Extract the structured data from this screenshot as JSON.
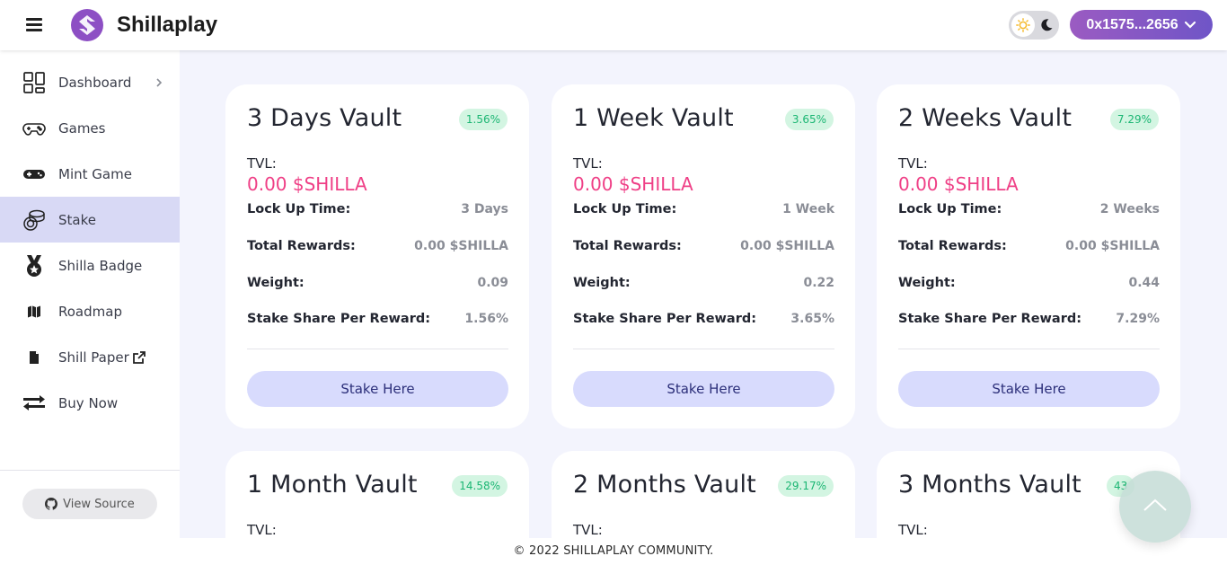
{
  "header": {
    "brand": "Shillaplay",
    "wallet": "0x1575...2656"
  },
  "sidebar": {
    "items": [
      {
        "label": "Dashboard",
        "icon": "dashboard-icon"
      },
      {
        "label": "Games",
        "icon": "gamepad-icon"
      },
      {
        "label": "Mint Game",
        "icon": "controller-icon"
      },
      {
        "label": "Stake",
        "icon": "coins-icon",
        "active": true
      },
      {
        "label": "Shilla Badge",
        "icon": "medal-icon"
      },
      {
        "label": "Roadmap",
        "icon": "map-icon"
      },
      {
        "label": "Shill Paper",
        "icon": "document-icon"
      },
      {
        "label": "Buy Now",
        "icon": "exchange-icon"
      }
    ],
    "view_source": "View Source"
  },
  "labels": {
    "tvl": "TVL:",
    "lock_up_time": "Lock Up Time:",
    "total_rewards": "Total Rewards:",
    "weight": "Weight:",
    "stake_share": "Stake Share Per Reward:",
    "stake_button": "Stake Here"
  },
  "vaults": [
    {
      "title": "3 Days Vault",
      "badge": "1.56%",
      "tvl": "0.00 $SHILLA",
      "lock_up_time": "3 Days",
      "total_rewards": "0.00 $SHILLA",
      "weight": "0.09",
      "stake_share": "1.56%"
    },
    {
      "title": "1 Week Vault",
      "badge": "3.65%",
      "tvl": "0.00 $SHILLA",
      "lock_up_time": "1 Week",
      "total_rewards": "0.00 $SHILLA",
      "weight": "0.22",
      "stake_share": "3.65%"
    },
    {
      "title": "2 Weeks Vault",
      "badge": "7.29%",
      "tvl": "0.00 $SHILLA",
      "lock_up_time": "2 Weeks",
      "total_rewards": "0.00 $SHILLA",
      "weight": "0.44",
      "stake_share": "7.29%"
    },
    {
      "title": "1 Month Vault",
      "badge": "14.58%"
    },
    {
      "title": "2 Months Vault",
      "badge": "29.17%"
    },
    {
      "title": "3 Months Vault",
      "badge": "43"
    }
  ],
  "footer": "© 2022 SHILLAPLAY COMMUNITY.",
  "colors": {
    "accent_pink": "#ef3f86",
    "badge_green": "#1bb673",
    "active_nav": "#d8d9f5",
    "wallet_gradient_start": "#9b5bc2",
    "wallet_gradient_end": "#6f55c7"
  }
}
